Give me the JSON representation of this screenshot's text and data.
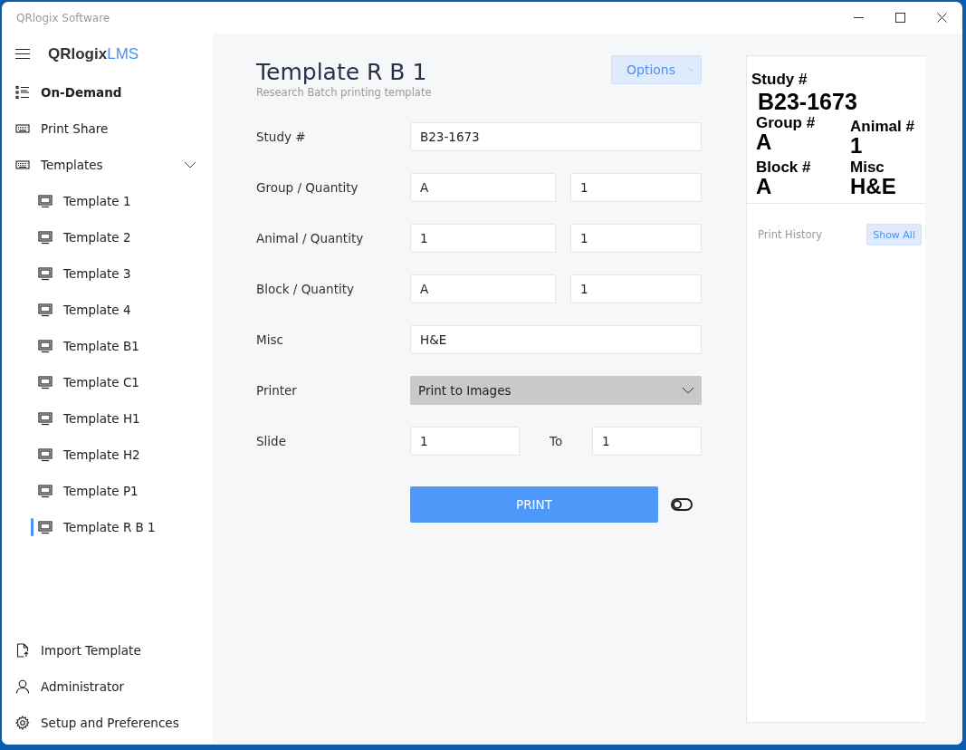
{
  "window": {
    "title": "QRlogix Software"
  },
  "logo": {
    "brand": "QRlogix",
    "suffix": "LMS"
  },
  "nav": [
    {
      "label": "On-Demand",
      "kind": "list",
      "selected": true
    },
    {
      "label": "Print Share",
      "kind": "keyboard",
      "selected": false
    },
    {
      "label": "Templates",
      "kind": "keyboard",
      "selected": false,
      "expanded": true,
      "children": [
        {
          "label": "Template 1",
          "selected": false
        },
        {
          "label": "Template 2",
          "selected": false
        },
        {
          "label": "Template 3",
          "selected": false
        },
        {
          "label": "Template 4",
          "selected": false
        },
        {
          "label": "Template B1",
          "selected": false
        },
        {
          "label": "Template C1",
          "selected": false
        },
        {
          "label": "Template H1",
          "selected": false
        },
        {
          "label": "Template H2",
          "selected": false
        },
        {
          "label": "Template P1",
          "selected": false
        },
        {
          "label": "Template R B 1",
          "selected": true
        }
      ]
    }
  ],
  "bottom_nav": [
    {
      "label": "Import Template",
      "kind": "file"
    },
    {
      "label": "Administrator",
      "kind": "person"
    },
    {
      "label": "Setup and Preferences",
      "kind": "gear"
    }
  ],
  "form": {
    "title": "Template R B 1",
    "subtitle": "Research Batch printing template",
    "options_button": "Options",
    "rows": [
      {
        "label": "Study #",
        "kind": "single",
        "value": "B23-1673"
      },
      {
        "label": "Group / Quantity",
        "kind": "pair",
        "value": "A",
        "quantity": "1"
      },
      {
        "label": "Animal / Quantity",
        "kind": "pair",
        "value": "1",
        "quantity": "1"
      },
      {
        "label": "Block / Quantity",
        "kind": "pair",
        "value": "A",
        "quantity": "1"
      },
      {
        "label": "Misc",
        "kind": "single",
        "value": "H&E"
      },
      {
        "label": "Printer",
        "kind": "dropdown",
        "value": "Print to Images"
      },
      {
        "label": "Slide",
        "kind": "range",
        "value": "1",
        "separator": "To",
        "quantity": "1"
      }
    ],
    "print_button": "PRINT",
    "toggle": {
      "on": false
    }
  },
  "preview": {
    "study_label": "Study #",
    "study_value": "B23-1673",
    "cells": [
      {
        "label": "Group #",
        "value": "A"
      },
      {
        "label": "Animal #",
        "value": "1"
      },
      {
        "label": "Block #",
        "value": "A"
      },
      {
        "label": "Misc",
        "value": "H&E"
      }
    ],
    "history_label": "Print History",
    "show_all_button": "Show All"
  }
}
